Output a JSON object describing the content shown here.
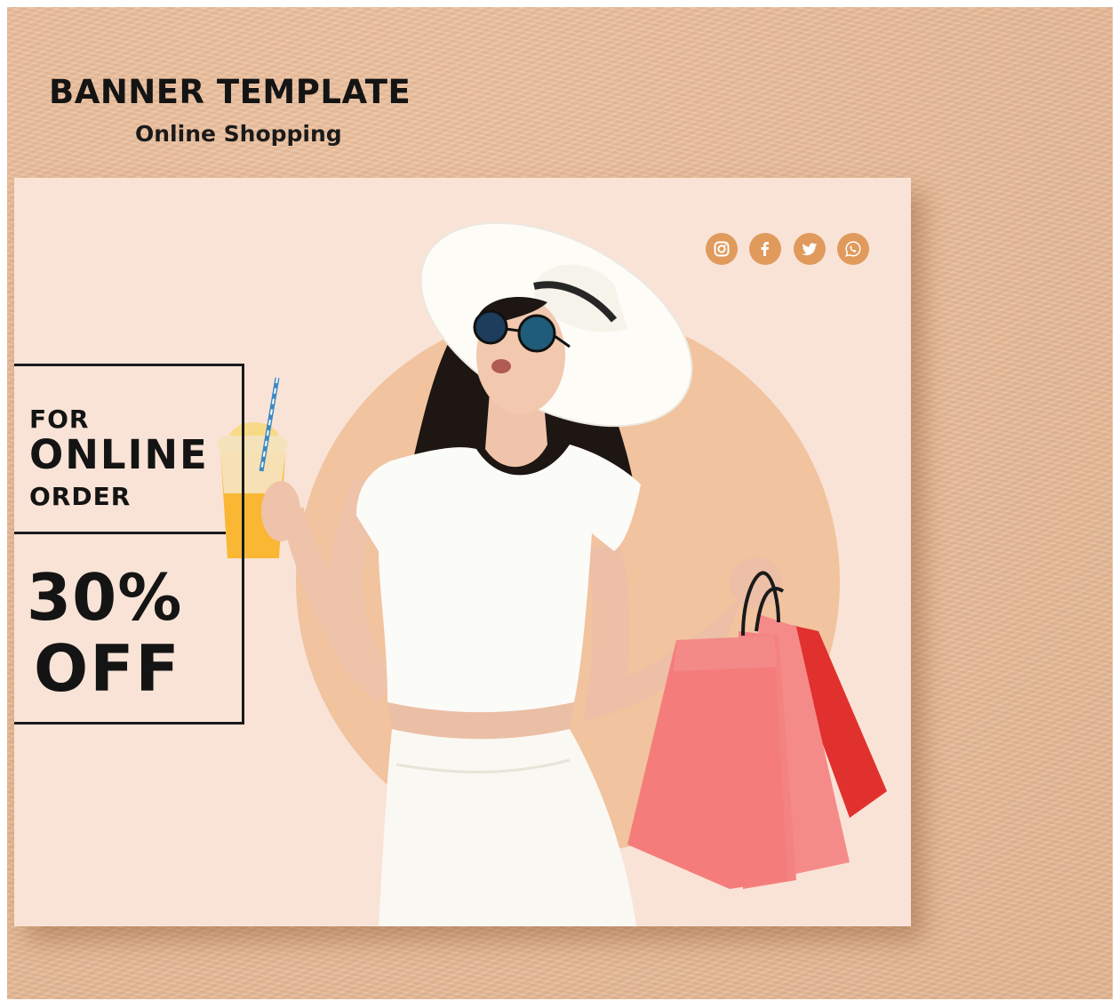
{
  "header": {
    "title": "BANNER TEMPLATE",
    "subtitle": "Online Shopping"
  },
  "banner": {
    "promo": {
      "line1": "FOR",
      "line2": "ONLINE",
      "line3": "ORDER",
      "discount": "30%",
      "off": "OFF"
    },
    "social_icons": [
      "instagram-icon",
      "facebook-icon",
      "twitter-icon",
      "whatsapp-icon"
    ]
  },
  "colors": {
    "background": "#efc09b",
    "banner_bg": "#f9e3d6",
    "circle": "#f1c39e",
    "icon": "#e09a5c",
    "text": "#141414",
    "bag": "#f07a78",
    "bag_dark": "#e0312f"
  }
}
